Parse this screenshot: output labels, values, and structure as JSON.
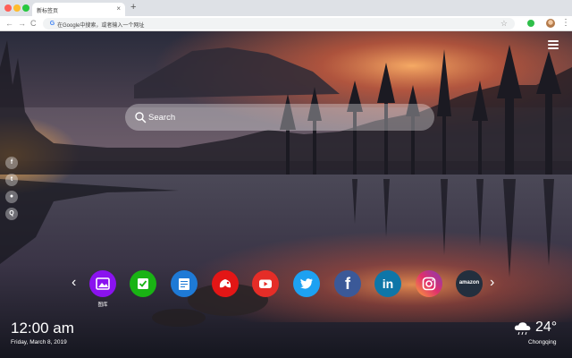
{
  "browser": {
    "tab_title": "新标签页",
    "tab_close": "×",
    "new_tab": "+",
    "address_placeholder": "在Google中搜索，或者输入一个网址",
    "nav": {
      "back": "←",
      "forward": "→",
      "reload": "C"
    },
    "google_letter": "G",
    "bookmark_icon": "☆",
    "menu_icon": "⋮"
  },
  "search": {
    "placeholder": "Search"
  },
  "rail": [
    {
      "name": "facebook",
      "glyph": "f"
    },
    {
      "name": "twitter",
      "glyph": "t"
    },
    {
      "name": "pin",
      "glyph": "●"
    },
    {
      "name": "search",
      "glyph": "Q"
    }
  ],
  "dock": {
    "prev": "‹",
    "next": "›",
    "first_label": "图库",
    "shortcuts": [
      {
        "name": "gallery",
        "color": "#8a12ef"
      },
      {
        "name": "tasks",
        "color": "#19b314"
      },
      {
        "name": "notes",
        "color": "#1e7ad6"
      },
      {
        "name": "games",
        "color": "#e31616"
      },
      {
        "name": "youtube",
        "color": "#e52d27"
      },
      {
        "name": "twitter",
        "color": "#1da1f2"
      },
      {
        "name": "facebook",
        "color": "#3b5998"
      },
      {
        "name": "linkedin",
        "color": "#0e76a8"
      },
      {
        "name": "instagram",
        "color": "#c13584"
      },
      {
        "name": "amazon",
        "color": "#232f3e"
      }
    ],
    "amazon_text": "amazon",
    "linkedin_text": "in",
    "facebook_text": "f"
  },
  "clock": {
    "time": "12:00 am",
    "date": "Friday, March 8, 2019"
  },
  "weather": {
    "temp": "24°",
    "city": "Chongqing",
    "icon": "cloud-rain-icon"
  }
}
